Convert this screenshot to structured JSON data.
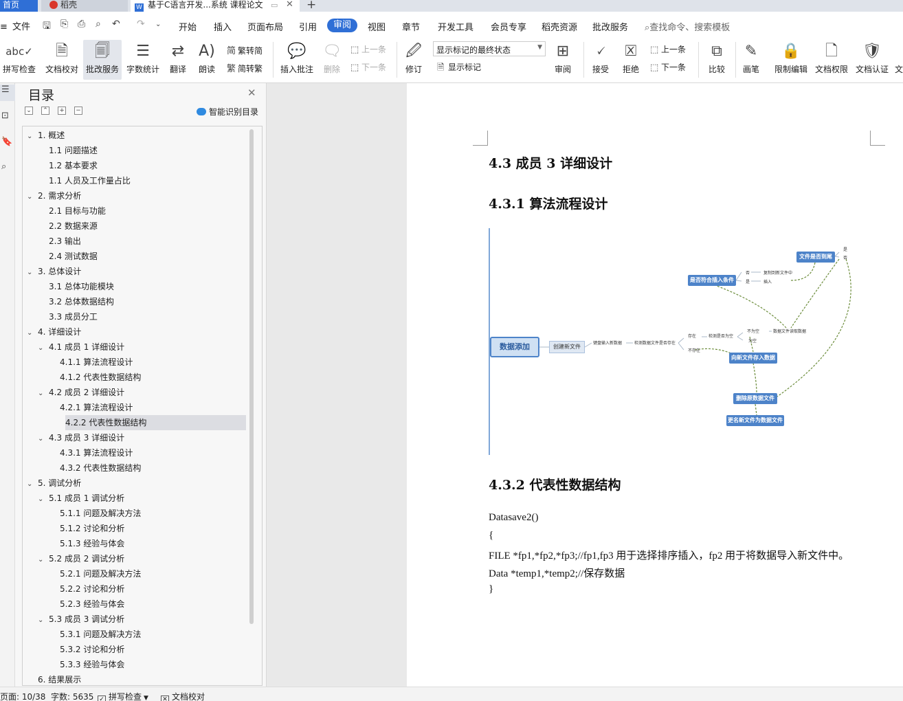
{
  "tabs": {
    "home": "首页",
    "daoke": "稻壳",
    "document": "基于C语言开发...系统 课程论文"
  },
  "menu": {
    "file": "文件",
    "tabs": [
      "开始",
      "插入",
      "页面布局",
      "引用",
      "审阅",
      "视图",
      "章节",
      "开发工具",
      "会员专享",
      "稻壳资源",
      "批改服务"
    ],
    "active_tab": "审阅",
    "search_placeholder": "查找命令、搜索模板"
  },
  "ribbon": {
    "spell_check": "拼写检查",
    "doc_proofread": "文档校对",
    "correction_service": "批改服务",
    "word_count": "字数统计",
    "translate": "翻译",
    "read_aloud": "朗读",
    "trad_to_simp": "繁转简",
    "simp_to_trad": "简转繁",
    "insert_comment": "插入批注",
    "delete": "删除",
    "prev": "上一条",
    "next": "下一条",
    "track_changes": "修订",
    "markup_mode": "显示标记的最终状态",
    "show_markup": "显示标记",
    "review": "审阅",
    "accept": "接受",
    "reject": "拒绝",
    "prev2": "上一条",
    "next2": "下一条",
    "compare": "比较",
    "pen": "画笔",
    "restrict_editing": "限制编辑",
    "doc_permissions": "文档权限",
    "doc_certification": "文档认证",
    "more": "文"
  },
  "nav": {
    "title": "目录",
    "smart_toc": "智能识别目录",
    "items": [
      {
        "text": "1.  概述",
        "level": 1,
        "caret": true
      },
      {
        "text": "1.1  问题描述",
        "level": 2,
        "caret": false
      },
      {
        "text": "1.2  基本要求",
        "level": 2,
        "caret": false
      },
      {
        "text": "1.1  人员及工作量占比",
        "level": 2,
        "caret": false
      },
      {
        "text": "2.  需求分析",
        "level": 1,
        "caret": true
      },
      {
        "text": "2.1  目标与功能",
        "level": 2,
        "caret": false
      },
      {
        "text": "2.2  数据来源",
        "level": 2,
        "caret": false
      },
      {
        "text": "2.3  输出",
        "level": 2,
        "caret": false
      },
      {
        "text": "2.4 测试数据",
        "level": 2,
        "caret": false
      },
      {
        "text": "3.  总体设计",
        "level": 1,
        "caret": true
      },
      {
        "text": "3.1  总体功能模块",
        "level": 2,
        "caret": false
      },
      {
        "text": "3.2  总体数据结构",
        "level": 2,
        "caret": false
      },
      {
        "text": "3.3  成员分工",
        "level": 2,
        "caret": false
      },
      {
        "text": "4.  详细设计",
        "level": 1,
        "caret": true
      },
      {
        "text": "4.1  成员 1 详细设计",
        "level": 2,
        "caret": true
      },
      {
        "text": "4.1.1  算法流程设计",
        "level": 3,
        "caret": false
      },
      {
        "text": "4.1.2  代表性数据结构",
        "level": 3,
        "caret": false
      },
      {
        "text": "4.2  成员 2 详细设计",
        "level": 2,
        "caret": true
      },
      {
        "text": "4.2.1  算法流程设计",
        "level": 3,
        "caret": false
      },
      {
        "text": "4.2.2  代表性数据结构",
        "level": 3,
        "caret": false,
        "selected": true
      },
      {
        "text": "4.3  成员 3 详细设计",
        "level": 2,
        "caret": true
      },
      {
        "text": "4.3.1  算法流程设计",
        "level": 3,
        "caret": false
      },
      {
        "text": "4.3.2  代表性数据结构",
        "level": 3,
        "caret": false
      },
      {
        "text": "5.  调试分析",
        "level": 1,
        "caret": true
      },
      {
        "text": "5.1  成员 1 调试分析",
        "level": 2,
        "caret": true
      },
      {
        "text": "5.1.1  问题及解决方法",
        "level": 3,
        "caret": false
      },
      {
        "text": "5.1.2  讨论和分析",
        "level": 3,
        "caret": false
      },
      {
        "text": "5.1.3  经验与体会",
        "level": 3,
        "caret": false
      },
      {
        "text": "5.2  成员 2 调试分析",
        "level": 2,
        "caret": true
      },
      {
        "text": "5.2.1  问题及解决方法",
        "level": 3,
        "caret": false
      },
      {
        "text": "5.2.2  讨论和分析",
        "level": 3,
        "caret": false
      },
      {
        "text": "5.2.3  经验与体会",
        "level": 3,
        "caret": false
      },
      {
        "text": "5.3  成员 3 调试分析",
        "level": 2,
        "caret": true
      },
      {
        "text": "5.3.1  问题及解决方法",
        "level": 3,
        "caret": false
      },
      {
        "text": "5.3.2  讨论和分析",
        "level": 3,
        "caret": false
      },
      {
        "text": "5.3.3  经验与体会",
        "level": 3,
        "caret": false
      },
      {
        "text": "6.  结果展示",
        "level": 1,
        "caret": false
      }
    ]
  },
  "document": {
    "heading_43": "4.3  成员 3 详细设计",
    "heading_431": "4.3.1  算法流程设计",
    "heading_432": "4.3.2  代表性数据结构",
    "code_lines": [
      "Datasave2()",
      "{",
      "FILE *fp1,*fp2,*fp3;//fp1,fp3 用于选择排序插入，fp2 用于将数据导入新文件中。",
      "Data *temp1,*temp2;//保存数据",
      "}"
    ],
    "mindmap": {
      "root": "数据添加",
      "create_file": "创建新文件",
      "input_new_data": "键盘输入新数据",
      "check_exists": "检测数据文件是否存在",
      "exists": "存在",
      "not_exists": "不存在",
      "check_empty": "检测是否为空",
      "not_empty": "不为空",
      "is_empty": "为空",
      "read_file": "数据文件读取数据",
      "meets_insert": "是否符合插入条件",
      "no": "否",
      "copy_to_new": "复制到新文件中",
      "yes": "是",
      "insert": "插入",
      "file_end": "文件是否到尾",
      "yes2": "是",
      "no2": "否",
      "save_to_new": "向新文件存入数据",
      "delete_old": "删除原数据文件",
      "rename_new": "更名新文件为数据文件"
    }
  },
  "status": {
    "page": "页面: 10/38",
    "words": "字数: 5635",
    "spell_check": "拼写检查",
    "doc_proofread": "文档校对"
  }
}
